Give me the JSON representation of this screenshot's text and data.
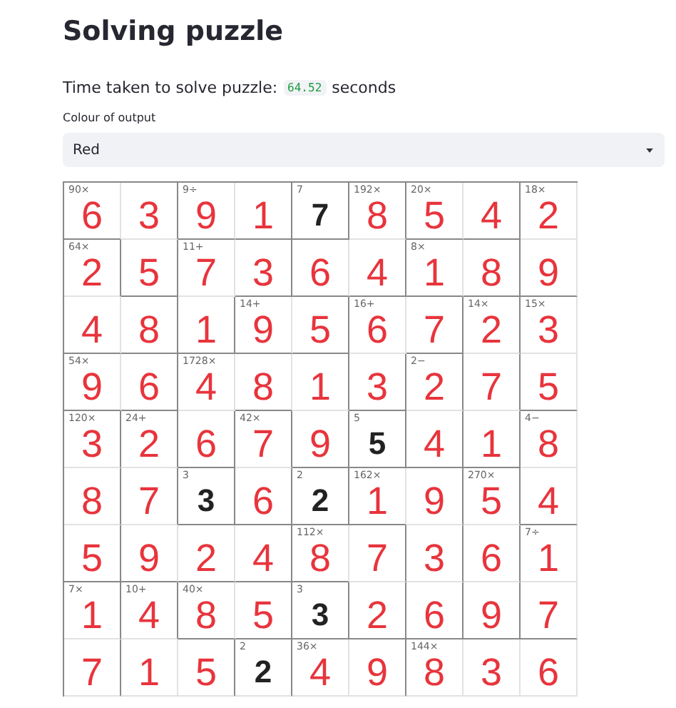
{
  "title": "Solving puzzle",
  "timing": {
    "label": "Time taken to solve puzzle:",
    "value": "64.52",
    "unit": "seconds"
  },
  "colour_select": {
    "label": "Colour of output",
    "value": "Red"
  },
  "grid": {
    "rows": [
      [
        {
          "value": "6",
          "given": false,
          "clue": "90×",
          "wall_right": false,
          "wall_bottom": true
        },
        {
          "value": "3",
          "given": false,
          "wall_right": true,
          "wall_bottom": false
        },
        {
          "value": "9",
          "given": false,
          "clue": "9÷",
          "wall_right": false,
          "wall_bottom": true
        },
        {
          "value": "1",
          "given": false,
          "wall_right": true,
          "wall_bottom": true
        },
        {
          "value": "7",
          "given": true,
          "clue": "7",
          "wall_right": true,
          "wall_bottom": true
        },
        {
          "value": "8",
          "given": false,
          "clue": "192×",
          "wall_right": true,
          "wall_bottom": false
        },
        {
          "value": "5",
          "given": false,
          "clue": "20×",
          "wall_right": false,
          "wall_bottom": true
        },
        {
          "value": "4",
          "given": false,
          "wall_right": true,
          "wall_bottom": true
        },
        {
          "value": "2",
          "given": false,
          "clue": "18×",
          "wall_right": false,
          "wall_bottom": false
        }
      ],
      [
        {
          "value": "2",
          "given": false,
          "clue": "64×",
          "wall_right": true,
          "wall_bottom": false
        },
        {
          "value": "5",
          "given": false,
          "wall_right": true,
          "wall_bottom": true
        },
        {
          "value": "7",
          "given": false,
          "clue": "11+",
          "wall_right": false,
          "wall_bottom": false
        },
        {
          "value": "3",
          "given": false,
          "wall_right": true,
          "wall_bottom": true
        },
        {
          "value": "6",
          "given": false,
          "wall_right": false,
          "wall_bottom": true
        },
        {
          "value": "4",
          "given": false,
          "wall_right": true,
          "wall_bottom": true
        },
        {
          "value": "1",
          "given": false,
          "clue": "8×",
          "wall_right": false,
          "wall_bottom": true
        },
        {
          "value": "8",
          "given": false,
          "wall_right": true,
          "wall_bottom": true
        },
        {
          "value": "9",
          "given": false,
          "wall_right": false,
          "wall_bottom": true
        }
      ],
      [
        {
          "value": "4",
          "given": false,
          "wall_right": false,
          "wall_bottom": true
        },
        {
          "value": "8",
          "given": false,
          "wall_right": true,
          "wall_bottom": true
        },
        {
          "value": "1",
          "given": false,
          "wall_right": true,
          "wall_bottom": true
        },
        {
          "value": "9",
          "given": false,
          "clue": "14+",
          "wall_right": false,
          "wall_bottom": true
        },
        {
          "value": "5",
          "given": false,
          "wall_right": true,
          "wall_bottom": true
        },
        {
          "value": "6",
          "given": false,
          "clue": "16+",
          "wall_right": false,
          "wall_bottom": false
        },
        {
          "value": "7",
          "given": false,
          "wall_right": true,
          "wall_bottom": true
        },
        {
          "value": "2",
          "given": false,
          "clue": "14×",
          "wall_right": true,
          "wall_bottom": false
        },
        {
          "value": "3",
          "given": false,
          "clue": "15×",
          "wall_right": false,
          "wall_bottom": false
        }
      ],
      [
        {
          "value": "9",
          "given": false,
          "clue": "54×",
          "wall_right": false,
          "wall_bottom": true
        },
        {
          "value": "6",
          "given": false,
          "wall_right": true,
          "wall_bottom": true
        },
        {
          "value": "4",
          "given": false,
          "clue": "1728×",
          "wall_right": false,
          "wall_bottom": false
        },
        {
          "value": "8",
          "given": false,
          "wall_right": false,
          "wall_bottom": true
        },
        {
          "value": "1",
          "given": false,
          "wall_right": true,
          "wall_bottom": false
        },
        {
          "value": "3",
          "given": false,
          "wall_right": true,
          "wall_bottom": true
        },
        {
          "value": "2",
          "given": false,
          "clue": "2−",
          "wall_right": true,
          "wall_bottom": false
        },
        {
          "value": "7",
          "given": false,
          "wall_right": true,
          "wall_bottom": false
        },
        {
          "value": "5",
          "given": false,
          "wall_right": false,
          "wall_bottom": true
        }
      ],
      [
        {
          "value": "3",
          "given": false,
          "clue": "120×",
          "wall_right": true,
          "wall_bottom": false
        },
        {
          "value": "2",
          "given": false,
          "clue": "24+",
          "wall_right": true,
          "wall_bottom": false
        },
        {
          "value": "6",
          "given": false,
          "wall_right": true,
          "wall_bottom": true
        },
        {
          "value": "7",
          "given": false,
          "clue": "42×",
          "wall_right": true,
          "wall_bottom": false
        },
        {
          "value": "9",
          "given": false,
          "wall_right": true,
          "wall_bottom": true
        },
        {
          "value": "5",
          "given": true,
          "clue": "5",
          "wall_right": true,
          "wall_bottom": true
        },
        {
          "value": "4",
          "given": false,
          "wall_right": true,
          "wall_bottom": true
        },
        {
          "value": "1",
          "given": false,
          "wall_right": true,
          "wall_bottom": true
        },
        {
          "value": "8",
          "given": false,
          "clue": "4−",
          "wall_right": false,
          "wall_bottom": false
        }
      ],
      [
        {
          "value": "8",
          "given": false,
          "wall_right": true,
          "wall_bottom": false
        },
        {
          "value": "7",
          "given": false,
          "wall_right": true,
          "wall_bottom": false
        },
        {
          "value": "3",
          "given": true,
          "clue": "3",
          "wall_right": true,
          "wall_bottom": true
        },
        {
          "value": "6",
          "given": false,
          "wall_right": true,
          "wall_bottom": true
        },
        {
          "value": "2",
          "given": true,
          "clue": "2",
          "wall_right": true,
          "wall_bottom": true
        },
        {
          "value": "1",
          "given": false,
          "clue": "162×",
          "wall_right": false,
          "wall_bottom": true
        },
        {
          "value": "9",
          "given": false,
          "wall_right": true,
          "wall_bottom": false
        },
        {
          "value": "5",
          "given": false,
          "clue": "270×",
          "wall_right": true,
          "wall_bottom": false
        },
        {
          "value": "4",
          "given": false,
          "wall_right": false,
          "wall_bottom": true
        }
      ],
      [
        {
          "value": "5",
          "given": false,
          "wall_right": true,
          "wall_bottom": true
        },
        {
          "value": "9",
          "given": false,
          "wall_right": false,
          "wall_bottom": true
        },
        {
          "value": "2",
          "given": false,
          "wall_right": false,
          "wall_bottom": true
        },
        {
          "value": "4",
          "given": false,
          "wall_right": true,
          "wall_bottom": true
        },
        {
          "value": "8",
          "given": false,
          "clue": "112×",
          "wall_right": false,
          "wall_bottom": true
        },
        {
          "value": "7",
          "given": false,
          "wall_right": true,
          "wall_bottom": false
        },
        {
          "value": "3",
          "given": false,
          "wall_right": true,
          "wall_bottom": false
        },
        {
          "value": "6",
          "given": false,
          "wall_right": true,
          "wall_bottom": false
        },
        {
          "value": "1",
          "given": false,
          "clue": "7÷",
          "wall_right": false,
          "wall_bottom": false
        }
      ],
      [
        {
          "value": "1",
          "given": false,
          "clue": "7×",
          "wall_right": true,
          "wall_bottom": false
        },
        {
          "value": "4",
          "given": false,
          "clue": "10+",
          "wall_right": true,
          "wall_bottom": false
        },
        {
          "value": "8",
          "given": false,
          "clue": "40×",
          "wall_right": false,
          "wall_bottom": true
        },
        {
          "value": "5",
          "given": false,
          "wall_right": true,
          "wall_bottom": true
        },
        {
          "value": "3",
          "given": true,
          "clue": "3",
          "wall_right": true,
          "wall_bottom": true
        },
        {
          "value": "2",
          "given": false,
          "wall_right": true,
          "wall_bottom": true
        },
        {
          "value": "6",
          "given": false,
          "wall_right": true,
          "wall_bottom": true
        },
        {
          "value": "9",
          "given": false,
          "wall_right": true,
          "wall_bottom": true
        },
        {
          "value": "7",
          "given": false,
          "wall_right": false,
          "wall_bottom": true
        }
      ],
      [
        {
          "value": "7",
          "given": false,
          "wall_right": true,
          "wall_bottom": false
        },
        {
          "value": "1",
          "given": false,
          "wall_right": false,
          "wall_bottom": false
        },
        {
          "value": "5",
          "given": false,
          "wall_right": true,
          "wall_bottom": false
        },
        {
          "value": "2",
          "given": true,
          "clue": "2",
          "wall_right": true,
          "wall_bottom": false
        },
        {
          "value": "4",
          "given": false,
          "clue": "36×",
          "wall_right": false,
          "wall_bottom": false
        },
        {
          "value": "9",
          "given": false,
          "wall_right": true,
          "wall_bottom": false
        },
        {
          "value": "8",
          "given": false,
          "clue": "144×",
          "wall_right": false,
          "wall_bottom": false
        },
        {
          "value": "3",
          "given": false,
          "wall_right": false,
          "wall_bottom": false
        },
        {
          "value": "6",
          "given": false,
          "wall_right": false,
          "wall_bottom": false
        }
      ]
    ]
  }
}
